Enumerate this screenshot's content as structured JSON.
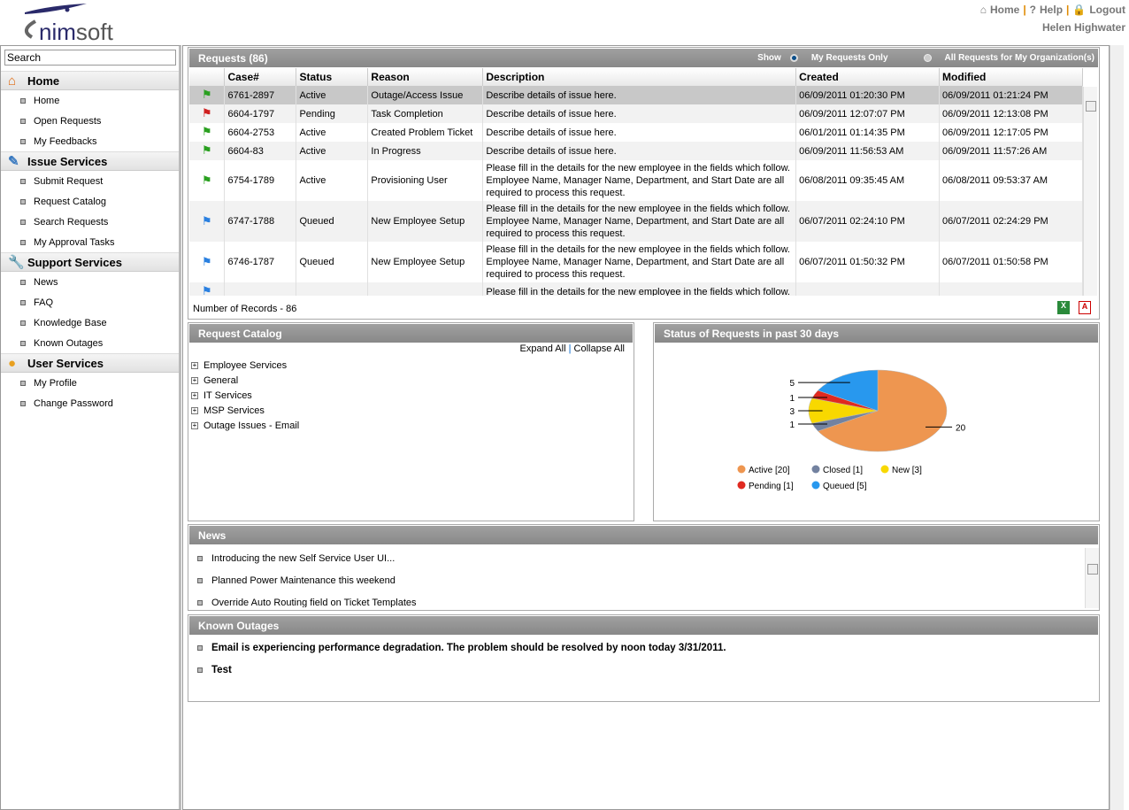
{
  "header": {
    "logo": "nimsoft",
    "links": [
      {
        "icon": "home-icon",
        "label": "Home"
      },
      {
        "icon": "help-icon",
        "label": "Help"
      },
      {
        "icon": "lock-icon",
        "label": "Logout"
      }
    ],
    "user": "Helen Highwater"
  },
  "sidebar": {
    "search_placeholder": "Search",
    "sections": [
      {
        "title": "Home",
        "icon": "house-icon",
        "items": [
          "Home",
          "Open Requests",
          "My Feedbacks"
        ]
      },
      {
        "title": "Issue Services",
        "icon": "pencil-icon",
        "items": [
          "Submit Request",
          "Request Catalog",
          "Search Requests",
          "My Approval Tasks"
        ]
      },
      {
        "title": "Support Services",
        "icon": "wrench-icon",
        "items": [
          "News",
          "FAQ",
          "Knowledge Base",
          "Known Outages"
        ]
      },
      {
        "title": "User Services",
        "icon": "user-icon",
        "items": [
          "My Profile",
          "Change Password"
        ]
      }
    ]
  },
  "requests": {
    "title": "Requests (86)",
    "show": "Show",
    "opt1": "My Requests Only",
    "opt2": "All Requests for My Organization(s)",
    "selected": "My Requests Only",
    "columns": [
      "",
      "Case#",
      "Status",
      "Reason",
      "Description",
      "Created",
      "Modified"
    ],
    "rows": [
      {
        "flag": "green",
        "case": "6761-2897",
        "status": "Active",
        "reason": "Outage/Access Issue",
        "desc": "Describe details of issue here.",
        "created": "06/09/2011 01:20:30 PM",
        "modified": "06/09/2011 01:21:24 PM"
      },
      {
        "flag": "red",
        "case": "6604-1797",
        "status": "Pending",
        "reason": "Task Completion",
        "desc": "Describe details of issue here.",
        "created": "06/09/2011 12:07:07 PM",
        "modified": "06/09/2011 12:13:08 PM"
      },
      {
        "flag": "green",
        "case": "6604-2753",
        "status": "Active",
        "reason": "Created Problem Ticket",
        "desc": "Describe details of issue here.",
        "created": "06/01/2011 01:14:35 PM",
        "modified": "06/09/2011 12:17:05 PM"
      },
      {
        "flag": "green",
        "case": "6604-83",
        "status": "Active",
        "reason": "In Progress",
        "desc": "Describe details of issue here.",
        "created": "06/09/2011 11:56:53 AM",
        "modified": "06/09/2011 11:57:26 AM"
      },
      {
        "flag": "green",
        "case": "6754-1789",
        "status": "Active",
        "reason": "Provisioning User",
        "desc": "Please fill in the details for the new employee in the fields which follow. Employee Name, Manager Name, Department, and Start Date are all required to process this request.",
        "created": "06/08/2011 09:35:45 AM",
        "modified": "06/08/2011 09:53:37 AM"
      },
      {
        "flag": "blue",
        "case": "6747-1788",
        "status": "Queued",
        "reason": "New Employee Setup",
        "desc": "Please fill in the details for the new employee in the fields which follow. Employee Name, Manager Name, Department, and Start Date are all required to process this request.",
        "created": "06/07/2011 02:24:10 PM",
        "modified": "06/07/2011 02:24:29 PM"
      },
      {
        "flag": "blue",
        "case": "6746-1787",
        "status": "Queued",
        "reason": "New Employee Setup",
        "desc": "Please fill in the details for the new employee in the fields which follow. Employee Name, Manager Name, Department, and Start Date are all required to process this request.",
        "created": "06/07/2011 01:50:32 PM",
        "modified": "06/07/2011 01:50:58 PM"
      },
      {
        "flag": "blue",
        "case": "",
        "status": "",
        "reason": "",
        "desc": "Please fill in the details for the new employee in the fields which follow.",
        "created": "",
        "modified": ""
      }
    ],
    "footer": "Number of Records - 86"
  },
  "catalog": {
    "title": "Request Catalog",
    "expand": "Expand All",
    "collapse": "Collapse All",
    "items": [
      "Employee Services",
      "General",
      "IT Services",
      "MSP Services",
      "Outage Issues - Email"
    ]
  },
  "chart_data": {
    "type": "pie",
    "title": "Status of Requests in past 30 days",
    "slices": [
      {
        "label": "Active",
        "value": 20,
        "color": "#ee9650"
      },
      {
        "label": "Closed",
        "value": 1,
        "color": "#7382a0"
      },
      {
        "label": "New",
        "value": 3,
        "color": "#f8d800"
      },
      {
        "label": "Pending",
        "value": 1,
        "color": "#e02a20"
      },
      {
        "label": "Queued",
        "value": 5,
        "color": "#2898ee"
      }
    ],
    "legend": "bottom"
  },
  "news": {
    "title": "News",
    "items": [
      "Introducing the new Self Service User UI...",
      "Planned Power Maintenance this weekend",
      "Override Auto Routing field on Ticket Templates"
    ]
  },
  "outages": {
    "title": "Known Outages",
    "items": [
      "Email is experiencing performance degradation. The problem should be resolved by noon today 3/31/2011.",
      "Test"
    ]
  }
}
